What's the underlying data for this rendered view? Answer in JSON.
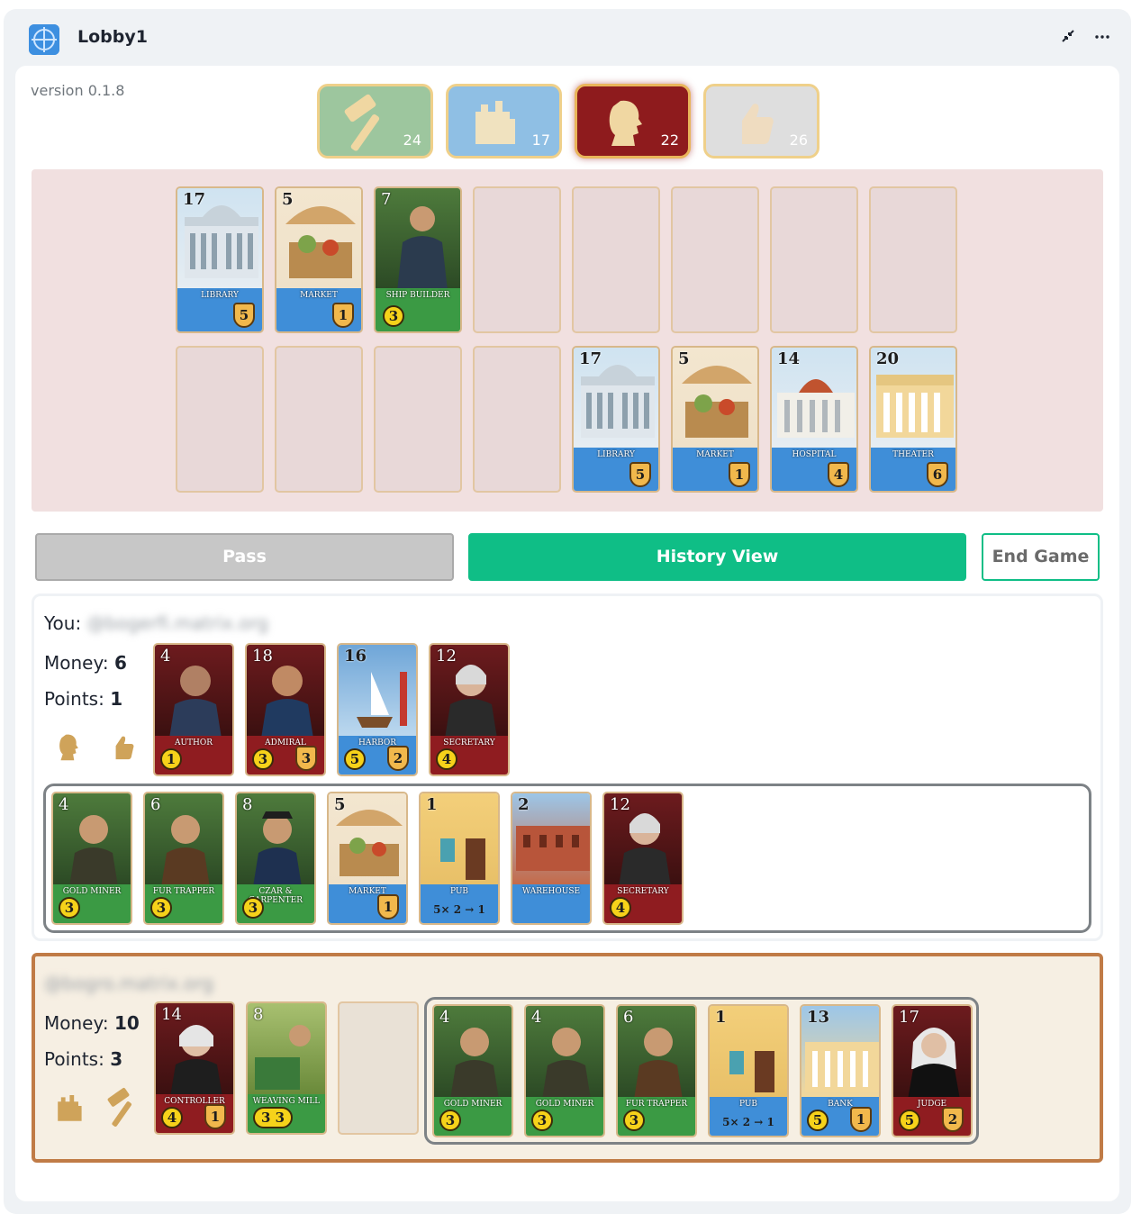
{
  "window": {
    "title": "Lobby1"
  },
  "version": "version 0.1.8",
  "resources": [
    {
      "id": "worker",
      "icon": "hammer-icon",
      "count": "24"
    },
    {
      "id": "building",
      "icon": "building-icon",
      "count": "17"
    },
    {
      "id": "aristocrat",
      "icon": "aristocrat-head-icon",
      "count": "22",
      "active": true
    },
    {
      "id": "trading",
      "icon": "thumbs-up-icon",
      "count": "26"
    }
  ],
  "board": {
    "top_row": [
      {
        "cost": "17",
        "name": "LIBRARY",
        "type": "blue",
        "points": "5"
      },
      {
        "cost": "5",
        "name": "MARKET",
        "type": "blue",
        "points": "1"
      },
      {
        "cost": "7",
        "name": "SHIP BUILDER",
        "type": "green",
        "money": "3"
      }
    ],
    "bottom_row": [
      {
        "cost": "17",
        "name": "LIBRARY",
        "type": "blue",
        "points": "5"
      },
      {
        "cost": "5",
        "name": "MARKET",
        "type": "blue",
        "points": "1"
      },
      {
        "cost": "14",
        "name": "HOSPITAL",
        "type": "blue",
        "points": "4"
      },
      {
        "cost": "20",
        "name": "THEATER",
        "type": "blue",
        "points": "6"
      }
    ]
  },
  "actions": {
    "pass": "Pass",
    "history": "History View",
    "end_game": "End Game"
  },
  "you": {
    "label": "You:",
    "name": "@bogerfi.matrix.org",
    "money_label": "Money:",
    "money": "6",
    "points_label": "Points:",
    "points": "1",
    "hand": [
      {
        "cost": "4",
        "name": "AUTHOR",
        "type": "red",
        "money": "1"
      },
      {
        "cost": "18",
        "name": "ADMIRAL",
        "type": "red",
        "money": "3",
        "points": "3"
      },
      {
        "cost": "16",
        "name": "HARBOR",
        "type": "blue",
        "money": "5",
        "points": "2"
      },
      {
        "cost": "12",
        "name": "SECRETARY",
        "type": "red",
        "money": "4"
      }
    ],
    "owned": [
      {
        "cost": "4",
        "name": "GOLD MINER",
        "type": "green",
        "money": "3"
      },
      {
        "cost": "6",
        "name": "FUR TRAPPER",
        "type": "green",
        "money": "3"
      },
      {
        "cost": "8",
        "name": "CZAR & CARPENTER",
        "type": "green",
        "money": "3"
      },
      {
        "cost": "5",
        "name": "MARKET",
        "type": "blue",
        "points": "1"
      },
      {
        "cost": "1",
        "name": "PUB",
        "type": "blue",
        "extra": "5× 2 → 1"
      },
      {
        "cost": "2",
        "name": "WAREHOUSE",
        "type": "blue"
      },
      {
        "cost": "12",
        "name": "SECRETARY",
        "type": "red",
        "money": "4"
      }
    ]
  },
  "opponent": {
    "name": "@bogro.matrix.org",
    "money_label": "Money:",
    "money": "10",
    "points_label": "Points:",
    "points": "3",
    "hand": [
      {
        "cost": "14",
        "name": "CONTROLLER",
        "type": "red",
        "money": "4",
        "points": "1"
      },
      {
        "cost": "8",
        "name": "WEAVING MILL",
        "type": "green",
        "money": "3 3"
      }
    ],
    "owned": [
      {
        "cost": "4",
        "name": "GOLD MINER",
        "type": "green",
        "money": "3"
      },
      {
        "cost": "4",
        "name": "GOLD MINER",
        "type": "green",
        "money": "3"
      },
      {
        "cost": "6",
        "name": "FUR TRAPPER",
        "type": "green",
        "money": "3"
      },
      {
        "cost": "1",
        "name": "PUB",
        "type": "blue",
        "extra": "5× 2 → 1"
      },
      {
        "cost": "13",
        "name": "BANK",
        "type": "blue",
        "money": "5",
        "points": "1"
      },
      {
        "cost": "17",
        "name": "JUDGE",
        "type": "red",
        "money": "5",
        "points": "2"
      }
    ]
  },
  "colors": {
    "accent": "#0fbe86",
    "board_bg": "#f1e0e0",
    "opponent_border": "#c07b46"
  }
}
